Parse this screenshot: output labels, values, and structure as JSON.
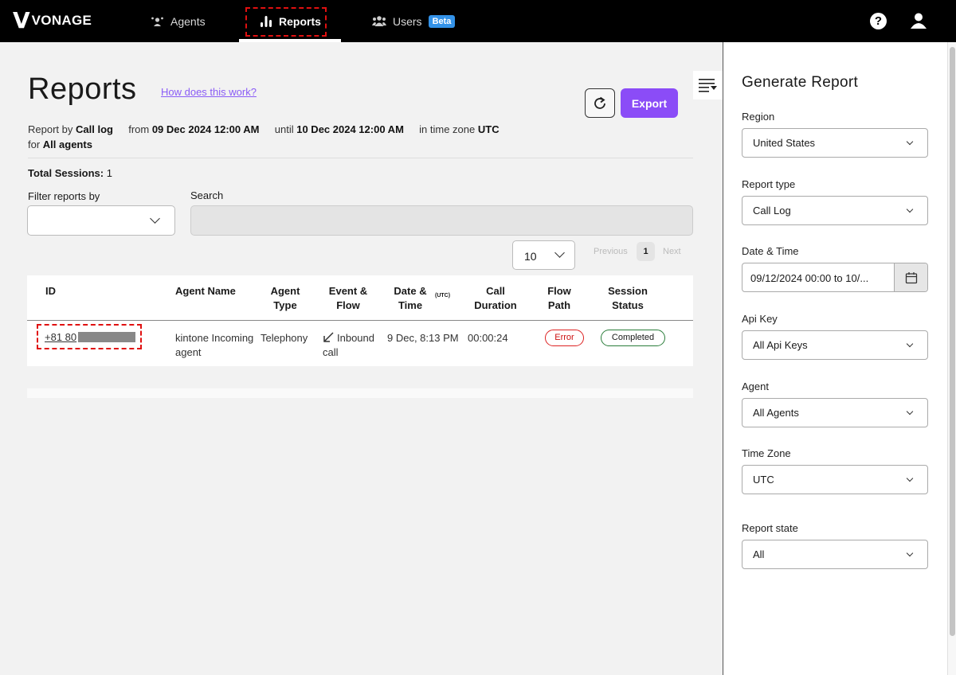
{
  "nav": {
    "brand": "VONAGE",
    "items": [
      {
        "label": "Agents",
        "icon": "agents-icon"
      },
      {
        "label": "Reports",
        "icon": "bar-chart-icon",
        "active": true
      },
      {
        "label": "Users",
        "icon": "users-icon",
        "badge": "Beta"
      }
    ],
    "help": "?"
  },
  "page": {
    "title": "Reports",
    "help_link": "How does this work?",
    "export_label": "Export",
    "meta": {
      "report_by_label": "Report by",
      "report_by_value": "Call log",
      "from_label": "from",
      "from_value": "09 Dec 2024 12:00 AM",
      "until_label": "until",
      "until_value": "10 Dec 2024 12:00 AM",
      "tz_label": "in time zone",
      "tz_value": "UTC",
      "for_label": "for",
      "for_value": "All agents"
    },
    "total_label": "Total Sessions:",
    "total_value": "1",
    "filter_label": "Filter reports by",
    "filter_value": "",
    "search_label": "Search",
    "search_value": "",
    "page_size": "10",
    "pagination": {
      "previous": "Previous",
      "current": "1",
      "next": "Next"
    }
  },
  "table": {
    "columns": {
      "id": "ID",
      "agent_name": [
        "Agent Name"
      ],
      "agent_type": [
        "Agent",
        "Type"
      ],
      "event_flow": [
        "Event &",
        "Flow"
      ],
      "date_time": [
        "Date &",
        "Time"
      ],
      "date_time_unit": "(UTC)",
      "duration": [
        "Call",
        "Duration"
      ],
      "flow_path": [
        "Flow",
        "Path"
      ],
      "session_status": [
        "Session",
        "Status"
      ]
    },
    "rows": [
      {
        "id": "+81 80",
        "agent_name": [
          "kintone Incoming",
          "agent"
        ],
        "agent_type": "Telephony",
        "event": [
          "Inbound",
          "call"
        ],
        "date_time": "9 Dec, 8:13 PM",
        "duration": "00:00:24",
        "flow_path": "Error",
        "status": "Completed"
      }
    ]
  },
  "sidebar": {
    "title": "Generate Report",
    "fields": [
      {
        "label": "Region",
        "value": "United States"
      },
      {
        "label": "Report type",
        "value": "Call Log"
      },
      {
        "label": "Date & Time",
        "value": "09/12/2024 00:00 to 10/..."
      },
      {
        "label": "Api Key",
        "value": "All Api Keys"
      },
      {
        "label": "Agent",
        "value": "All Agents"
      },
      {
        "label": "Time Zone",
        "value": "UTC"
      },
      {
        "label": "Report state",
        "value": "All"
      }
    ]
  },
  "colors": {
    "accent": "#8b4cf7",
    "link": "#8a5cf6",
    "beta": "#3392e8",
    "error": "#cc1111",
    "success": "#2a7d3a",
    "annotation": "#e01010"
  }
}
